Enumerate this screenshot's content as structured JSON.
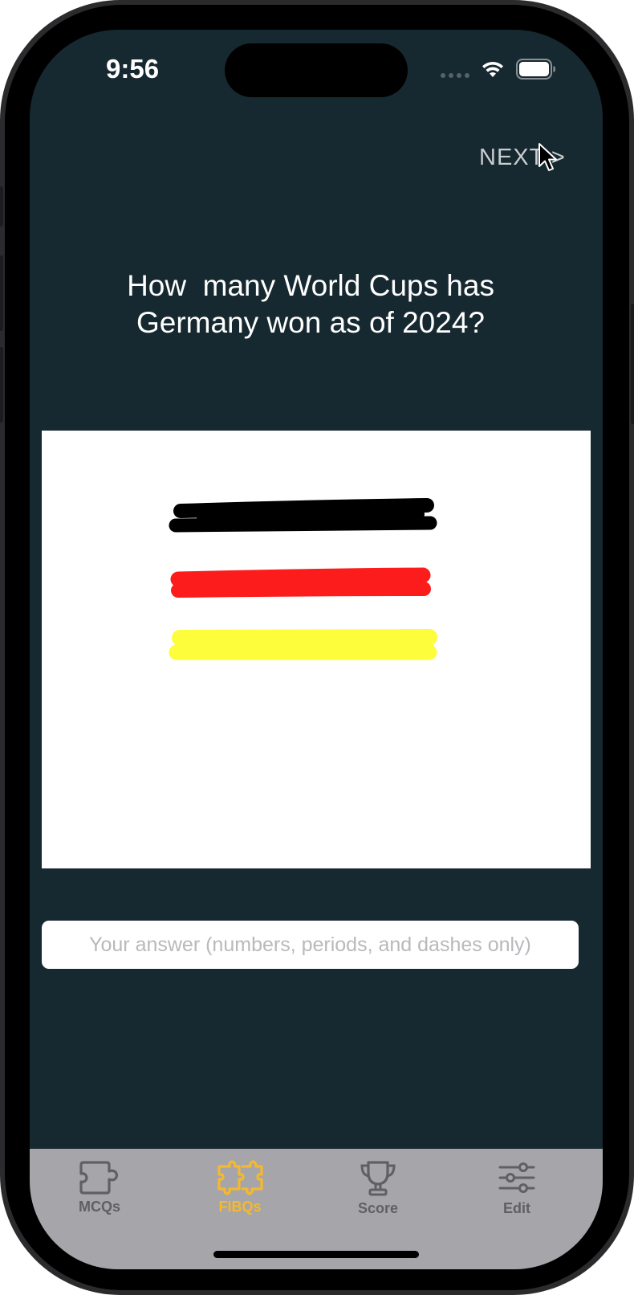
{
  "status_bar": {
    "time": "9:56"
  },
  "header": {
    "next_label": "NEXT >"
  },
  "question": {
    "text": "How  many World Cups has\nGermany won as of 2024?"
  },
  "drawing_canvas": {
    "strokes": [
      {
        "color": "#000000",
        "name": "black"
      },
      {
        "color": "#fc1c1c",
        "name": "red"
      },
      {
        "color": "#fdfd3c",
        "name": "yellow"
      }
    ]
  },
  "answer": {
    "value": "",
    "placeholder": "Your answer (numbers, periods, and dashes only)"
  },
  "tab_bar": {
    "active_color": "#f5b82e",
    "inactive_color": "#5f5f64",
    "tabs": [
      {
        "label": "MCQs",
        "icon": "puzzle-outline-icon",
        "active": false
      },
      {
        "label": "FIBQs",
        "icon": "puzzle-pieces-icon",
        "active": true
      },
      {
        "label": "Score",
        "icon": "trophy-icon",
        "active": false
      },
      {
        "label": "Edit",
        "icon": "sliders-icon",
        "active": false
      }
    ]
  },
  "colors": {
    "background": "#172930",
    "tab_bar_background": "#a6a6aa"
  }
}
